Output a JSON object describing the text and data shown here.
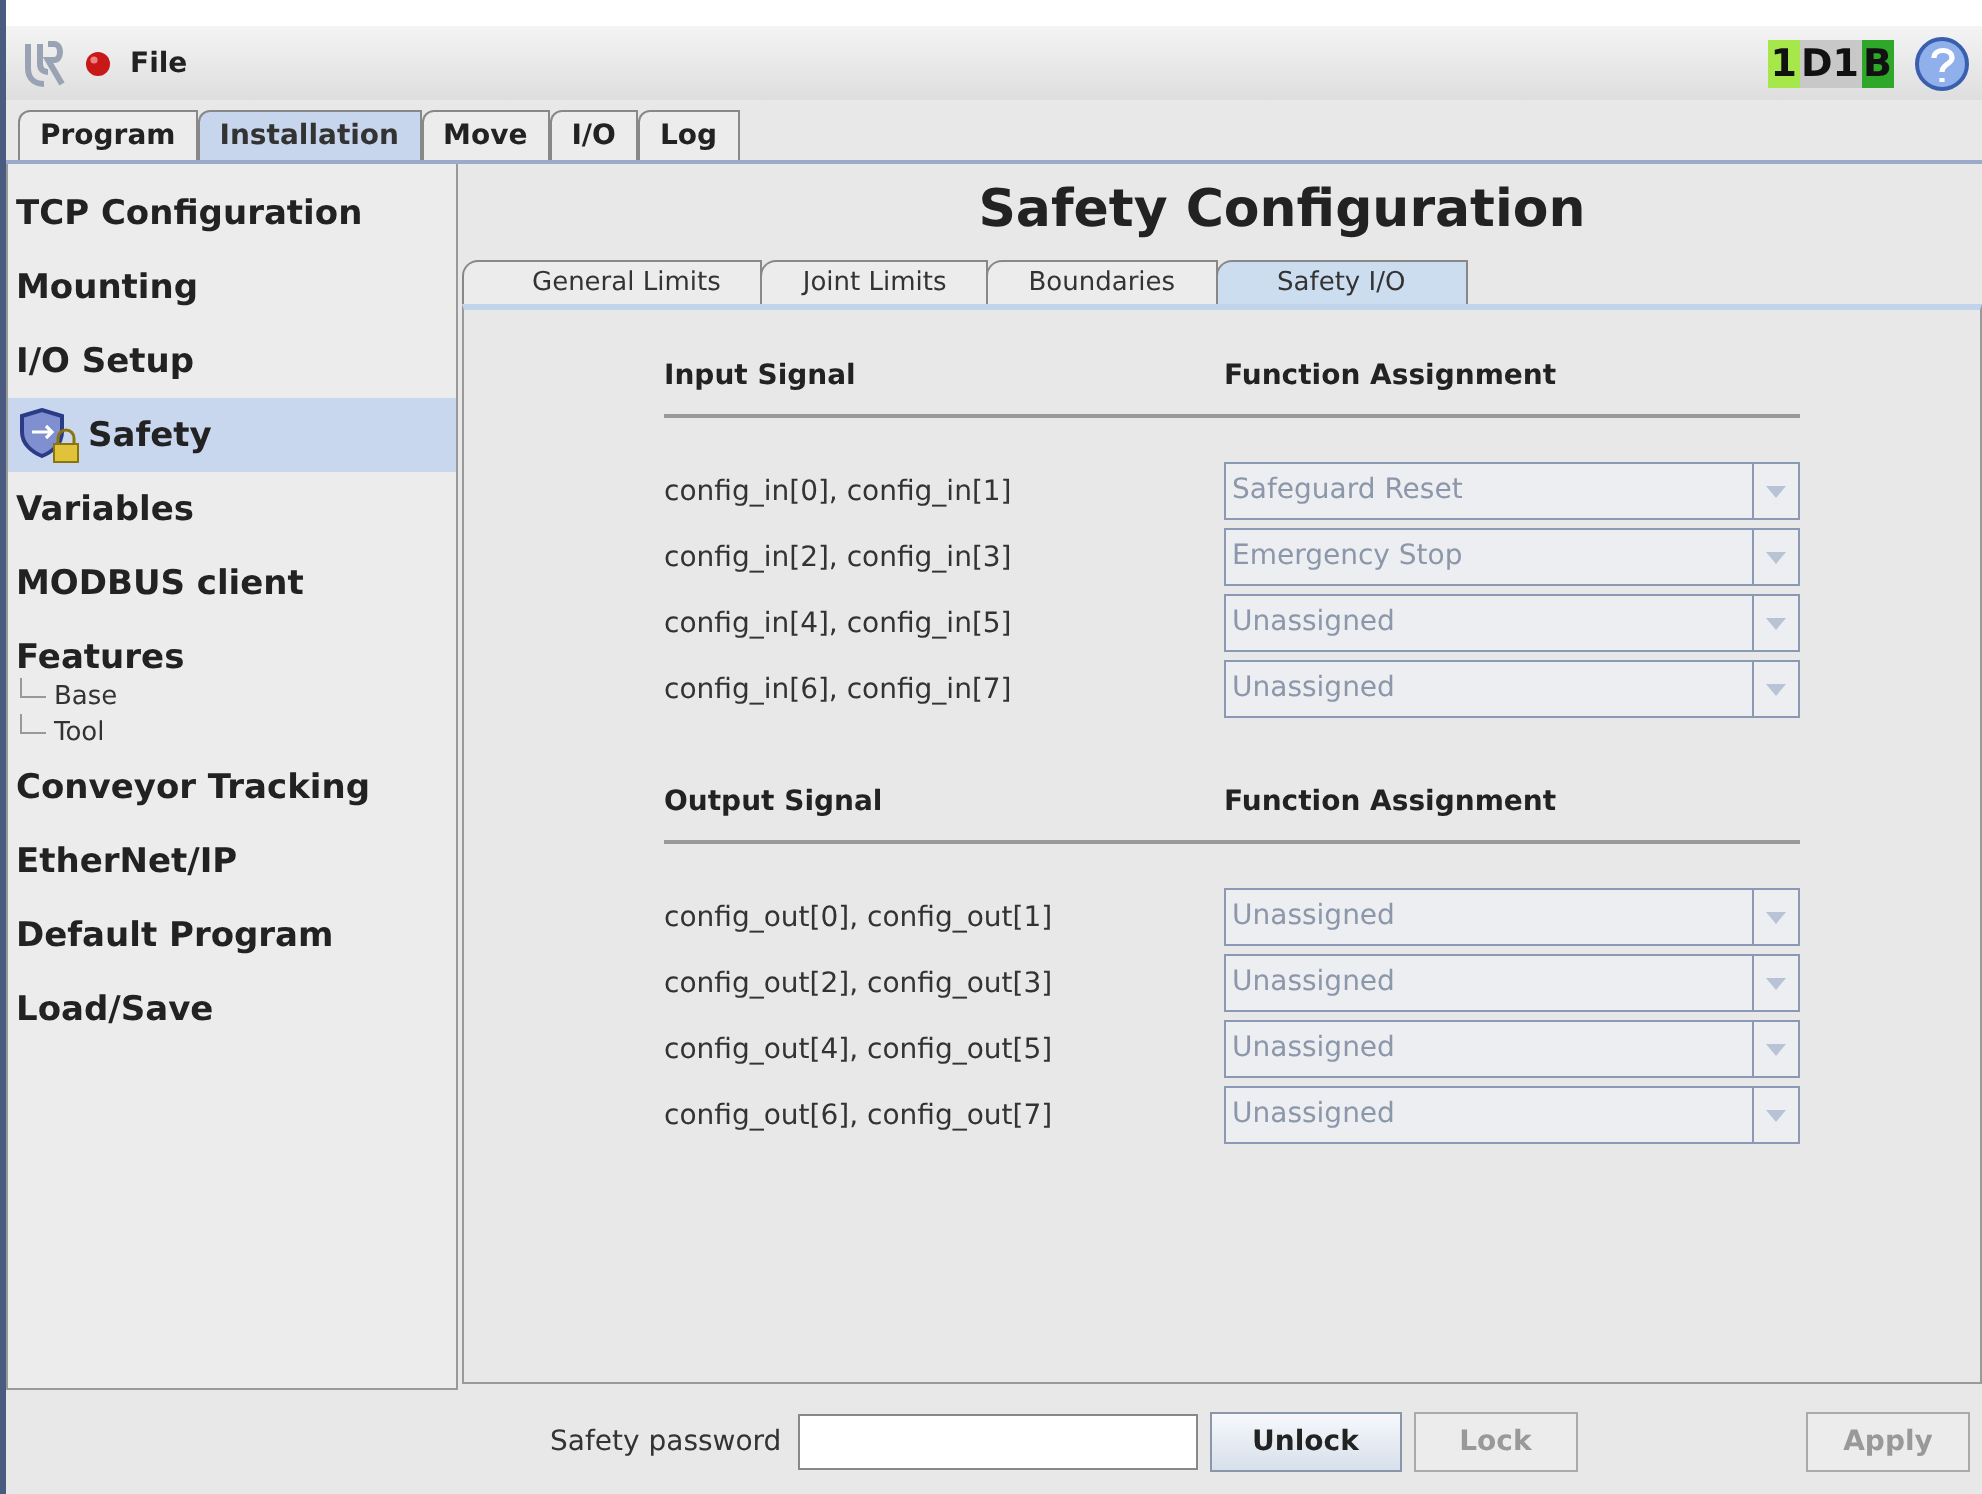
{
  "menu": {
    "file": "File"
  },
  "status_badge": [
    {
      "text": "1",
      "color": "#a6e84a"
    },
    {
      "text": "D1",
      "color": "#c8c8c8"
    },
    {
      "text": "B",
      "color": "#2fa82a"
    }
  ],
  "main_tabs": [
    {
      "label": "Program",
      "selected": false
    },
    {
      "label": "Installation",
      "selected": true
    },
    {
      "label": "Move",
      "selected": false
    },
    {
      "label": "I/O",
      "selected": false
    },
    {
      "label": "Log",
      "selected": false
    }
  ],
  "sidebar": {
    "items": [
      {
        "label": "TCP Configuration",
        "selected": false
      },
      {
        "label": "Mounting",
        "selected": false
      },
      {
        "label": "I/O Setup",
        "selected": false
      },
      {
        "label": "Safety",
        "selected": true,
        "has_icon": true
      },
      {
        "label": "Variables",
        "selected": false
      },
      {
        "label": "MODBUS client",
        "selected": false
      },
      {
        "label": "Features",
        "selected": false,
        "children": [
          {
            "label": "Base"
          },
          {
            "label": "Tool"
          }
        ]
      },
      {
        "label": "Conveyor Tracking",
        "selected": false
      },
      {
        "label": "EtherNet/IP",
        "selected": false
      },
      {
        "label": "Default Program",
        "selected": false
      },
      {
        "label": "Load/Save",
        "selected": false
      }
    ]
  },
  "title": "Safety Configuration",
  "sub_tabs": [
    {
      "label": "General Limits",
      "selected": false
    },
    {
      "label": "Joint Limits",
      "selected": false
    },
    {
      "label": "Boundaries",
      "selected": false
    },
    {
      "label": "Safety I/O",
      "selected": true
    }
  ],
  "sections": [
    {
      "signal_heading": "Input Signal",
      "function_heading": "Function Assignment",
      "rows": [
        {
          "signal": "config_in[0], config_in[1]",
          "value": "Safeguard Reset",
          "disabled": true
        },
        {
          "signal": "config_in[2], config_in[3]",
          "value": "Emergency Stop",
          "disabled": true
        },
        {
          "signal": "config_in[4], config_in[5]",
          "value": "Unassigned",
          "disabled": true
        },
        {
          "signal": "config_in[6], config_in[7]",
          "value": "Unassigned",
          "disabled": true
        }
      ]
    },
    {
      "signal_heading": "Output Signal",
      "function_heading": "Function Assignment",
      "rows": [
        {
          "signal": "config_out[0], config_out[1]",
          "value": "Unassigned",
          "disabled": true
        },
        {
          "signal": "config_out[2], config_out[3]",
          "value": "Unassigned",
          "disabled": true
        },
        {
          "signal": "config_out[4], config_out[5]",
          "value": "Unassigned",
          "disabled": true
        },
        {
          "signal": "config_out[6], config_out[7]",
          "value": "Unassigned",
          "disabled": true
        }
      ]
    }
  ],
  "footer": {
    "password_label": "Safety password",
    "buttons": [
      {
        "label": "Unlock",
        "disabled": false
      },
      {
        "label": "Lock",
        "disabled": true
      }
    ],
    "apply": {
      "label": "Apply",
      "disabled": true
    }
  }
}
